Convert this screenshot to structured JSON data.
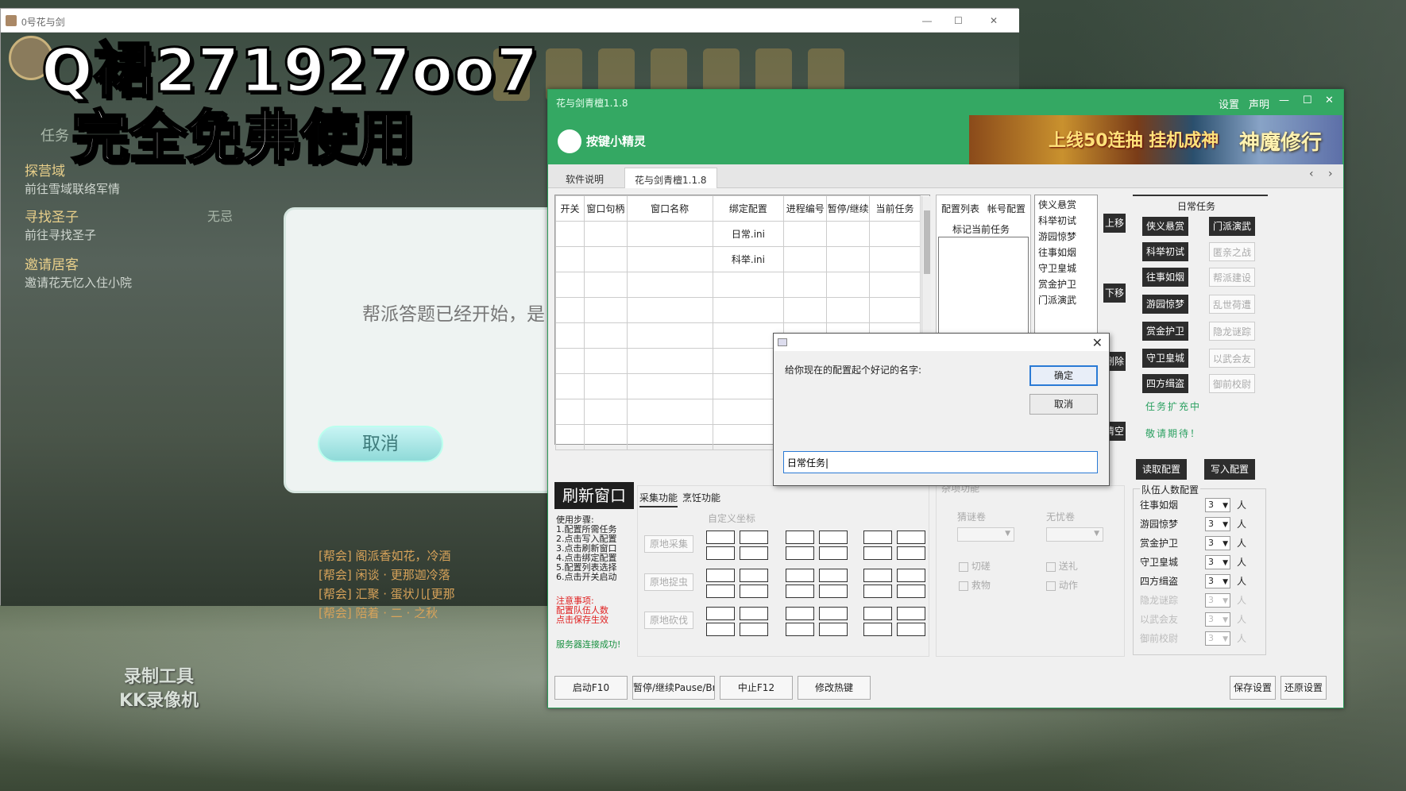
{
  "game_window": {
    "title": "0号花与剑",
    "controls": {
      "minimize": "—",
      "maximize": "☐",
      "close": "✕"
    }
  },
  "overlay": {
    "line1": "Q裙271927oo7",
    "line2": "完全免弗使用"
  },
  "quests": [
    {
      "title": "探营域",
      "sub": "前往雪域联络军情"
    },
    {
      "title": "寻找圣子",
      "sub": "前往寻找圣子"
    },
    {
      "title": "邀请居客",
      "sub": "邀请花无忆入住小院"
    }
  ],
  "quest_tab": "任务",
  "quest_side": "无忌",
  "game_dialog": {
    "message": "帮派答题已经开始，是",
    "cancel": "取消"
  },
  "chat_lines": [
    "[帮会] 阁派香如花，冷酒",
    "[帮会] 闲谈 · 更那迦冷落",
    "[帮会] 汇聚 · 蛋状儿[更那",
    "[帮会] 陪着 · 二 · 之秋"
  ],
  "recorder_watermark": {
    "line1": "录制工具",
    "line2": "KK录像机"
  },
  "tool": {
    "title": "花与剑青檀1.1.8",
    "top_links": [
      "设置",
      "声明"
    ],
    "window_controls": {
      "minimize": "—",
      "maximize": "☐",
      "close": "✕"
    },
    "brand": "按键小精灵",
    "banner": {
      "left": "上线50连抽 挂机成神",
      "right": "神魔修行"
    },
    "tabs": [
      "软件说明",
      "花与剑青檀1.1.8"
    ],
    "grid": {
      "headers": [
        "开关",
        "窗口句柄",
        "窗口名称",
        "绑定配置",
        "进程编号",
        "暂停/继续",
        "当前任务"
      ],
      "rows": [
        [
          "",
          "",
          "",
          "日常.ini",
          "",
          "",
          ""
        ],
        [
          "",
          "",
          "",
          "科举.ini",
          "",
          "",
          ""
        ],
        [
          "",
          "",
          "",
          "",
          "",
          "",
          ""
        ],
        [
          "",
          "",
          "",
          "",
          "",
          "",
          ""
        ],
        [
          "",
          "",
          "",
          "",
          "",
          "",
          ""
        ],
        [
          "",
          "",
          "",
          "",
          "",
          "",
          ""
        ],
        [
          "",
          "",
          "",
          "",
          "",
          "",
          ""
        ],
        [
          "",
          "",
          "",
          "",
          "",
          "",
          ""
        ],
        [
          "",
          "",
          "",
          "",
          "",
          "",
          ""
        ]
      ]
    },
    "config_tabs": [
      "配置列表",
      "帐号配置"
    ],
    "mark_current": "标记当前任务",
    "task_list": [
      "侠义悬赏",
      "科举初试",
      "游园惊梦",
      "往事如烟",
      "守卫皇城",
      "赏金护卫",
      "门派演武"
    ],
    "side_buttons": [
      "上移",
      "下移",
      "删除",
      "清空"
    ],
    "daily": {
      "title": "日常任务",
      "active": [
        "侠义悬赏",
        "门派演武",
        "科举初试",
        "往事如烟",
        "游园惊梦",
        "赏金护卫",
        "守卫皇城",
        "四方缉盗"
      ],
      "disabled": [
        "匿亲之战",
        "帮派建设",
        "乱世荷遭",
        "隐龙谜踪",
        "以武会友",
        "御前校尉"
      ],
      "note1": "任务扩充中",
      "note2": "敬请期待！"
    },
    "read_config": "读取配置",
    "write_config": "写入配置",
    "team": {
      "title": "队伍人数配置",
      "rows": [
        {
          "name": "往事如烟",
          "value": "3",
          "unit": "人"
        },
        {
          "name": "游园惊梦",
          "value": "3",
          "unit": "人"
        },
        {
          "name": "赏金护卫",
          "value": "3",
          "unit": "人"
        },
        {
          "name": "守卫皇城",
          "value": "3",
          "unit": "人"
        },
        {
          "name": "四方缉盗",
          "value": "3",
          "unit": "人"
        },
        {
          "name": "隐龙谜踪",
          "value": "3",
          "unit": "人"
        },
        {
          "name": "以武会友",
          "value": "3",
          "unit": "人"
        },
        {
          "name": "御前校尉",
          "value": "3",
          "unit": "人"
        }
      ]
    },
    "refresh": "刷新窗口",
    "steps_title": "使用步骤:",
    "steps": [
      "1.配置所需任务",
      "2.点击写入配置",
      "3.点击刷新窗口",
      "4.点击绑定配置",
      "5.配置列表选择",
      "6.点击开关启动"
    ],
    "notice_title": "注意事项:",
    "notices": [
      "配置队伍人数",
      "点击保存生效"
    ],
    "server": "服务器连接成功!",
    "func_tabs": [
      "采集功能",
      "烹饪功能"
    ],
    "custom_coord": "自定义坐标",
    "gather_rows": [
      "原地采集",
      "原地捉虫",
      "原地砍伐"
    ],
    "misc_label": "杂项功能",
    "misc_left": "猜谜卷",
    "misc_right": "无忧卷",
    "checks": [
      "切磋",
      "送礼",
      "救物",
      "动作"
    ],
    "bottom_buttons": [
      "启动F10",
      "暂停/继续Pause/Break",
      "中止F12",
      "修改热键"
    ],
    "save": "保存设置",
    "restore": "还原设置"
  },
  "modal": {
    "prompt": "给你现在的配置起个好记的名字:",
    "ok": "确定",
    "cancel": "取消",
    "input_value": "日常任务|",
    "close": "✕"
  }
}
